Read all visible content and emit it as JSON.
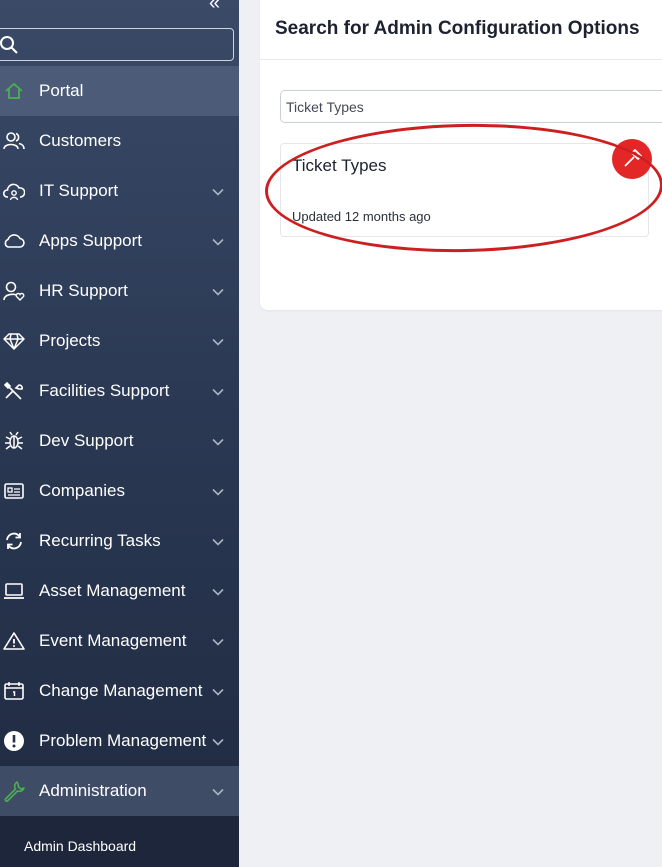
{
  "sidebar": {
    "collapse_glyph": "«",
    "search": {
      "value": "",
      "placeholder": ""
    },
    "items": [
      {
        "label": "Portal",
        "icon": "home-icon",
        "active": true
      },
      {
        "label": "Customers",
        "icon": "users-icon"
      },
      {
        "label": "IT Support",
        "icon": "cloud-person-icon"
      },
      {
        "label": "Apps Support",
        "icon": "cloud-icon"
      },
      {
        "label": "HR Support",
        "icon": "person-heart-icon"
      },
      {
        "label": "Projects",
        "icon": "diamond-icon"
      },
      {
        "label": "Facilities Support",
        "icon": "tools-icon"
      },
      {
        "label": "Dev Support",
        "icon": "bug-icon"
      },
      {
        "label": "Companies",
        "icon": "id-card-icon"
      },
      {
        "label": "Recurring Tasks",
        "icon": "refresh-icon"
      },
      {
        "label": "Asset Management",
        "icon": "laptop-icon"
      },
      {
        "label": "Event Management",
        "icon": "warning-icon"
      },
      {
        "label": "Change Management",
        "icon": "calendar-icon"
      },
      {
        "label": "Problem Management",
        "icon": "exclamation-circle-icon"
      },
      {
        "label": "Administration",
        "icon": "wrench-icon"
      }
    ],
    "submenu": {
      "label": "Admin Dashboard"
    }
  },
  "main": {
    "title": "Search for Admin Configuration Options",
    "filter_value": "Ticket Types",
    "result": {
      "title": "Ticket Types",
      "updated": "Updated 12 months ago",
      "icon": "hammer-icon",
      "icon_color": "#e32727"
    },
    "annotation_color": "#cc2020"
  },
  "colors": {
    "sidebar_top": "#3a4a67",
    "sidebar_bottom": "#1f2a40",
    "active_item": "#4c5b77",
    "accent_green": "#4caf50"
  }
}
